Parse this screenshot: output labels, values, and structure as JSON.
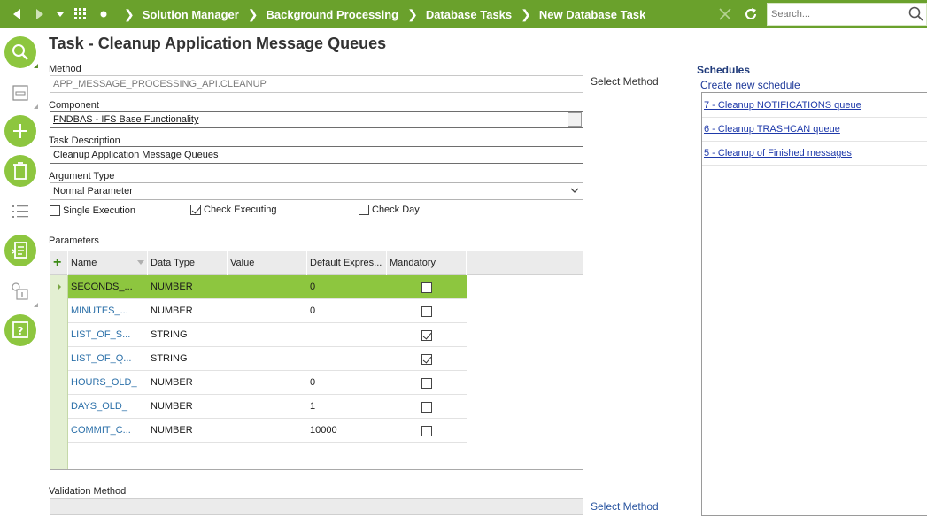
{
  "topbar": {
    "breadcrumbs": [
      "Solution Manager",
      "Background Processing",
      "Database Tasks",
      "New Database Task"
    ],
    "search_placeholder": "Search...",
    "accent_color": "#6aa12c"
  },
  "page": {
    "title": "Task - Cleanup Application Message Queues"
  },
  "form": {
    "method_label": "Method",
    "method_value": "APP_MESSAGE_PROCESSING_API.CLEANUP",
    "select_method_label": "Select Method",
    "component_label": "Component",
    "component_value": "FNDBAS - IFS Base Functionality",
    "component_lov": "...",
    "task_description_label": "Task Description",
    "task_description_value": "Cleanup Application Message Queues",
    "argument_type_label": "Argument Type",
    "argument_type_value": "Normal Parameter",
    "single_execution_label": "Single Execution",
    "single_execution_checked": false,
    "check_executing_label": "Check Executing",
    "check_executing_checked": true,
    "check_day_label": "Check Day",
    "check_day_checked": false,
    "parameters_label": "Parameters",
    "validation_method_label": "Validation Method",
    "validation_select_method_label": "Select Method"
  },
  "parameters": {
    "add_symbol": "+",
    "columns": [
      "Name",
      "Data Type",
      "Value",
      "Default Expres...",
      "Mandatory"
    ],
    "rows": [
      {
        "name": "SECONDS_...",
        "data_type": "NUMBER",
        "value": "",
        "default": "0",
        "mandatory": false,
        "selected": true
      },
      {
        "name": "MINUTES_...",
        "data_type": "NUMBER",
        "value": "",
        "default": "0",
        "mandatory": false,
        "selected": false
      },
      {
        "name": "LIST_OF_S...",
        "data_type": "STRING",
        "value": "",
        "default": "",
        "mandatory": true,
        "selected": false
      },
      {
        "name": "LIST_OF_Q...",
        "data_type": "STRING",
        "value": "",
        "default": "",
        "mandatory": true,
        "selected": false
      },
      {
        "name": "HOURS_OLD_",
        "data_type": "NUMBER",
        "value": "",
        "default": "0",
        "mandatory": false,
        "selected": false
      },
      {
        "name": "DAYS_OLD_",
        "data_type": "NUMBER",
        "value": "",
        "default": "1",
        "mandatory": false,
        "selected": false
      },
      {
        "name": "COMMIT_C...",
        "data_type": "NUMBER",
        "value": "",
        "default": "10000",
        "mandatory": false,
        "selected": false
      }
    ]
  },
  "schedules": {
    "title": "Schedules",
    "create_label": "Create new schedule",
    "items": [
      "7 - Cleanup NOTIFICATIONS queue",
      "6 - Cleanup TRASHCAN queue",
      "5 - Cleanup of Finished messages"
    ]
  },
  "sidebar": {
    "icons": [
      "search-icon",
      "form-view-icon",
      "add-icon",
      "delete-icon",
      "list-view-icon",
      "document-icon",
      "info-icon",
      "help-icon"
    ]
  }
}
